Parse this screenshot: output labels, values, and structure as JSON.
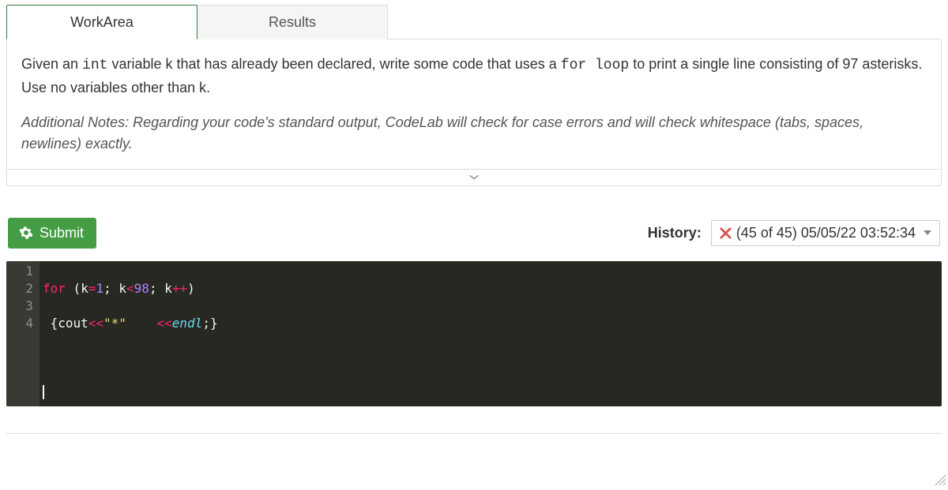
{
  "tabs": {
    "workarea": "WorkArea",
    "results": "Results"
  },
  "problem": {
    "t0": "Given an ",
    "t1": "int",
    "t2": " variable k that has already been declared, write some code that uses a ",
    "t3": "for loop",
    "t4": " to print a single line consisting of 97 asterisks. Use no variables other than k.",
    "notes": "Additional Notes: Regarding your code's standard output, CodeLab will check for case errors and will check whitespace (tabs, spaces, newlines) exactly."
  },
  "submit_label": "Submit",
  "history": {
    "label": "History:",
    "entry": "(45 of 45) 05/05/22 03:52:34"
  },
  "code": {
    "lines": [
      "1",
      "2",
      "3",
      "4"
    ],
    "l1": {
      "for": "for",
      "op": "(",
      "k": "k",
      "eq": "=",
      "n1": "1",
      "sc": ";",
      "sp": " ",
      "lt": "<",
      "n2": "98",
      "pp": "++",
      "cp": ")"
    },
    "l2": {
      "ob": "{",
      "cout": "cout",
      "ins": "<<",
      "str": "\"*\"",
      "sp": "    ",
      "endl": "endl",
      "term": ";",
      "cb": "}"
    }
  }
}
